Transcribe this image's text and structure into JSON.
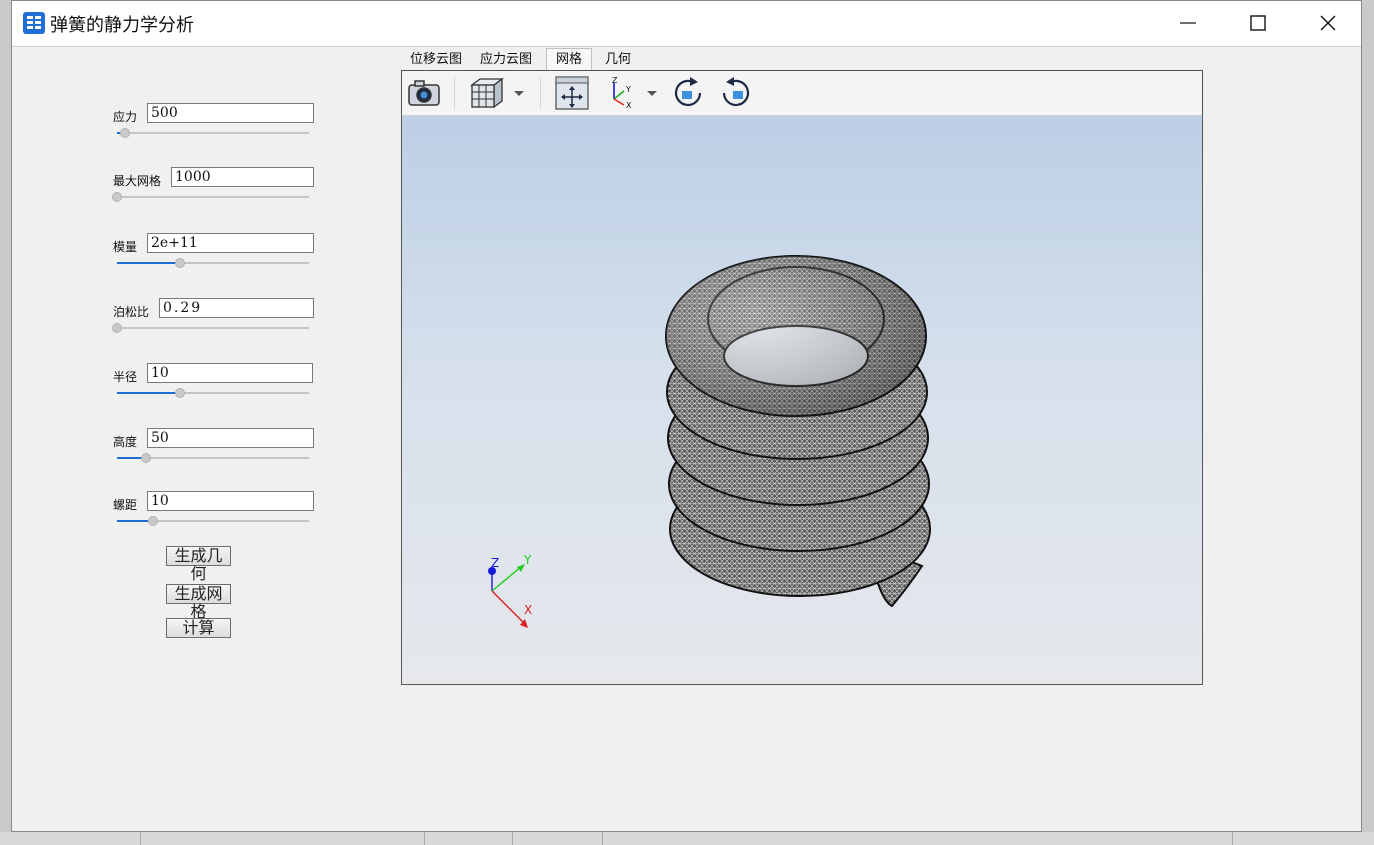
{
  "window": {
    "title": "弹簧的静力学分析"
  },
  "params": [
    {
      "label": "应力",
      "value": "500",
      "slider": 0.04
    },
    {
      "label": "最大网格",
      "value": "1000",
      "slider": 0.0
    },
    {
      "label": "模量",
      "value": "2e+11",
      "slider": 0.33
    },
    {
      "label": "泊松比",
      "value": "0.29",
      "slider": 0.0
    },
    {
      "label": "半径",
      "value": "10",
      "slider": 0.33
    },
    {
      "label": "高度",
      "value": "50",
      "slider": 0.15
    },
    {
      "label": "螺距",
      "value": "10",
      "slider": 0.19
    }
  ],
  "buttons": {
    "gen_geometry": "生成几何",
    "gen_mesh": "生成网格",
    "compute": "计算"
  },
  "tabs": [
    "位移云图",
    "应力云图",
    "网格",
    "几何"
  ],
  "active_tab": "网格",
  "triad": {
    "x": "X",
    "y": "Y",
    "z": "Z"
  },
  "toolbar_icons": [
    "camera-icon",
    "view-cube-icon",
    "dropdown-arrow-icon",
    "fit-all-icon",
    "axes-orientation-icon",
    "dropdown-arrow-icon",
    "rotate-clockwise-icon",
    "rotate-counterclockwise-icon"
  ],
  "colors": {
    "accent": "#1e6fd1",
    "x_axis": "#e0201e",
    "y_axis": "#22cc22",
    "z_axis": "#1a1ad6"
  }
}
